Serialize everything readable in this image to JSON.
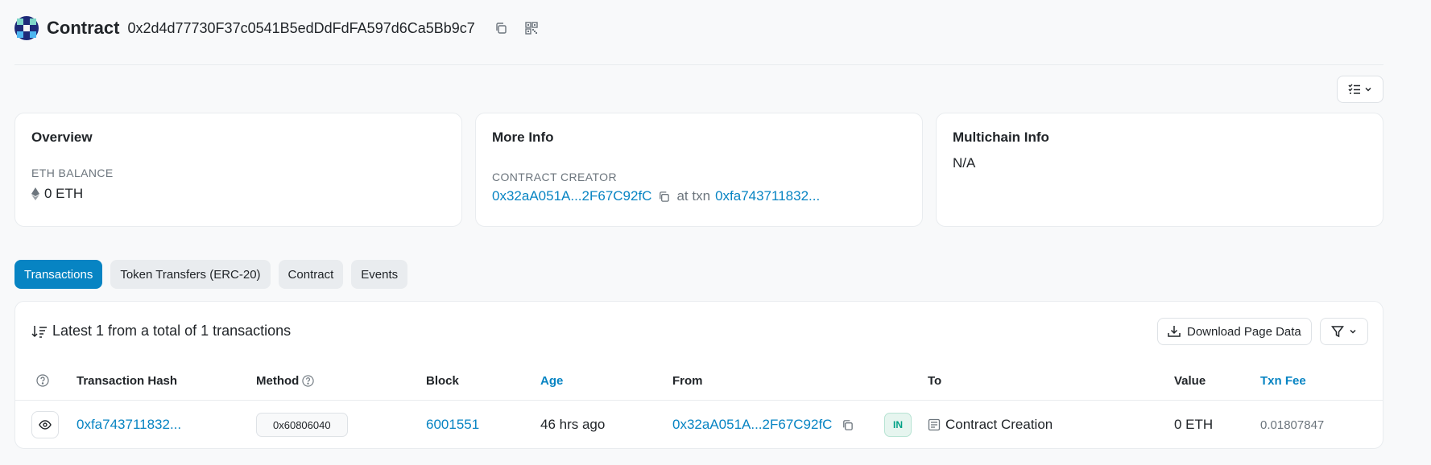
{
  "header": {
    "title": "Contract",
    "address": "0x2d4d77730F37c0541B5edDdFdFA597d6Ca5Bb9c7"
  },
  "overview": {
    "title": "Overview",
    "balance_label": "ETH BALANCE",
    "balance_value": "0 ETH"
  },
  "more_info": {
    "title": "More Info",
    "creator_label": "CONTRACT CREATOR",
    "creator_address": "0x32aA051A...2F67C92fC",
    "at_txn_text": "at txn",
    "creator_txn": "0xfa743711832..."
  },
  "multichain": {
    "title": "Multichain Info",
    "value": "N/A"
  },
  "tabs": [
    {
      "label": "Transactions",
      "active": true
    },
    {
      "label": "Token Transfers (ERC-20)",
      "active": false
    },
    {
      "label": "Contract",
      "active": false
    },
    {
      "label": "Events",
      "active": false
    }
  ],
  "transactions": {
    "summary": "Latest 1 from a total of 1 transactions",
    "download_label": "Download Page Data",
    "columns": {
      "hash": "Transaction Hash",
      "method": "Method",
      "block": "Block",
      "age": "Age",
      "from": "From",
      "to": "To",
      "value": "Value",
      "fee": "Txn Fee"
    },
    "rows": [
      {
        "hash": "0xfa743711832...",
        "method": "0x60806040",
        "block": "6001551",
        "age": "46 hrs ago",
        "from": "0x32aA051A...2F67C92fC",
        "direction": "IN",
        "to": "Contract Creation",
        "value": "0 ETH",
        "fee": "0.01807847"
      }
    ]
  },
  "colors": {
    "accent": "#0784c3",
    "in_badge": "#00a186",
    "muted": "#6c757d"
  }
}
